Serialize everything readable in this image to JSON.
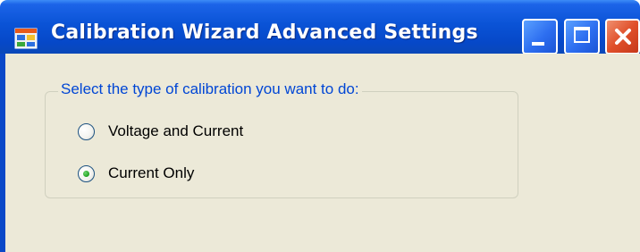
{
  "window": {
    "title": "Calibration Wizard Advanced Settings",
    "icons": {
      "app": "app-window-icon",
      "minimize": "minimize-icon",
      "maximize": "maximize-icon",
      "close": "close-icon"
    }
  },
  "group": {
    "legend": "Select the type of calibration you want to do:",
    "options": [
      {
        "label": "Voltage and Current",
        "selected": false
      },
      {
        "label": "Current Only",
        "selected": true
      }
    ]
  },
  "colors": {
    "titlebar": "#0a53d6",
    "client_bg": "#ece9d8",
    "legend_text": "#0046d5",
    "close_button": "#e0502a",
    "radio_selected": "#21a121"
  }
}
